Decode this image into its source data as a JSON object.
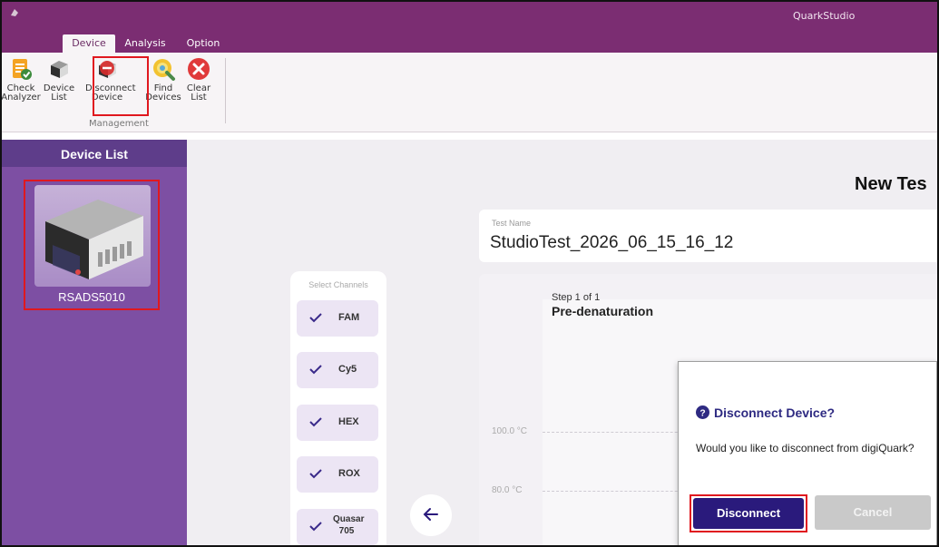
{
  "window": {
    "title": "QuarkStudio"
  },
  "tabs": [
    {
      "label": "Device",
      "active": true
    },
    {
      "label": "Analysis",
      "active": false
    },
    {
      "label": "Option",
      "active": false
    }
  ],
  "ribbon": {
    "buttons": [
      {
        "label": "Check\nAnalyzer",
        "icon": "check-analyzer-icon"
      },
      {
        "label": "Device\nList",
        "icon": "device-list-icon"
      },
      {
        "label": "Disconnect\nDevice",
        "icon": "disconnect-device-icon"
      },
      {
        "label": "Find\nDevices",
        "icon": "find-devices-icon"
      },
      {
        "label": "Clear\nList",
        "icon": "clear-list-icon"
      }
    ],
    "group_label": "Management"
  },
  "sidebar": {
    "title": "Device List",
    "device": {
      "name": "RSADS5010"
    }
  },
  "main": {
    "title": "New Tes",
    "test_name_label": "Test Name",
    "test_name_value": "StudioTest_2026_06_15_16_12",
    "channels_label": "Select Channels",
    "channels": [
      {
        "name": "FAM",
        "checked": true
      },
      {
        "name": "Cy5",
        "checked": true
      },
      {
        "name": "HEX",
        "checked": true
      },
      {
        "name": "ROX",
        "checked": true
      },
      {
        "name": "Quasar 705",
        "line1": "Quasar",
        "line2": "705",
        "checked": true
      }
    ],
    "step": {
      "of": "Step 1 of 1",
      "name": "Pre-denaturation"
    },
    "y_ticks": [
      "100.0 °C",
      "80.0 °C"
    ]
  },
  "dialog": {
    "title": "Disconnect Device?",
    "message": "Would you like to disconnect from digiQuark?",
    "confirm_label": "Disconnect",
    "cancel_label": "Cancel"
  },
  "colors": {
    "titlebar": "#7b2d72",
    "sidebar": "#7d4fa3",
    "dialog_title": "#2e2a82",
    "primary_button": "#2a1a7c",
    "highlight": "#e0181f"
  }
}
